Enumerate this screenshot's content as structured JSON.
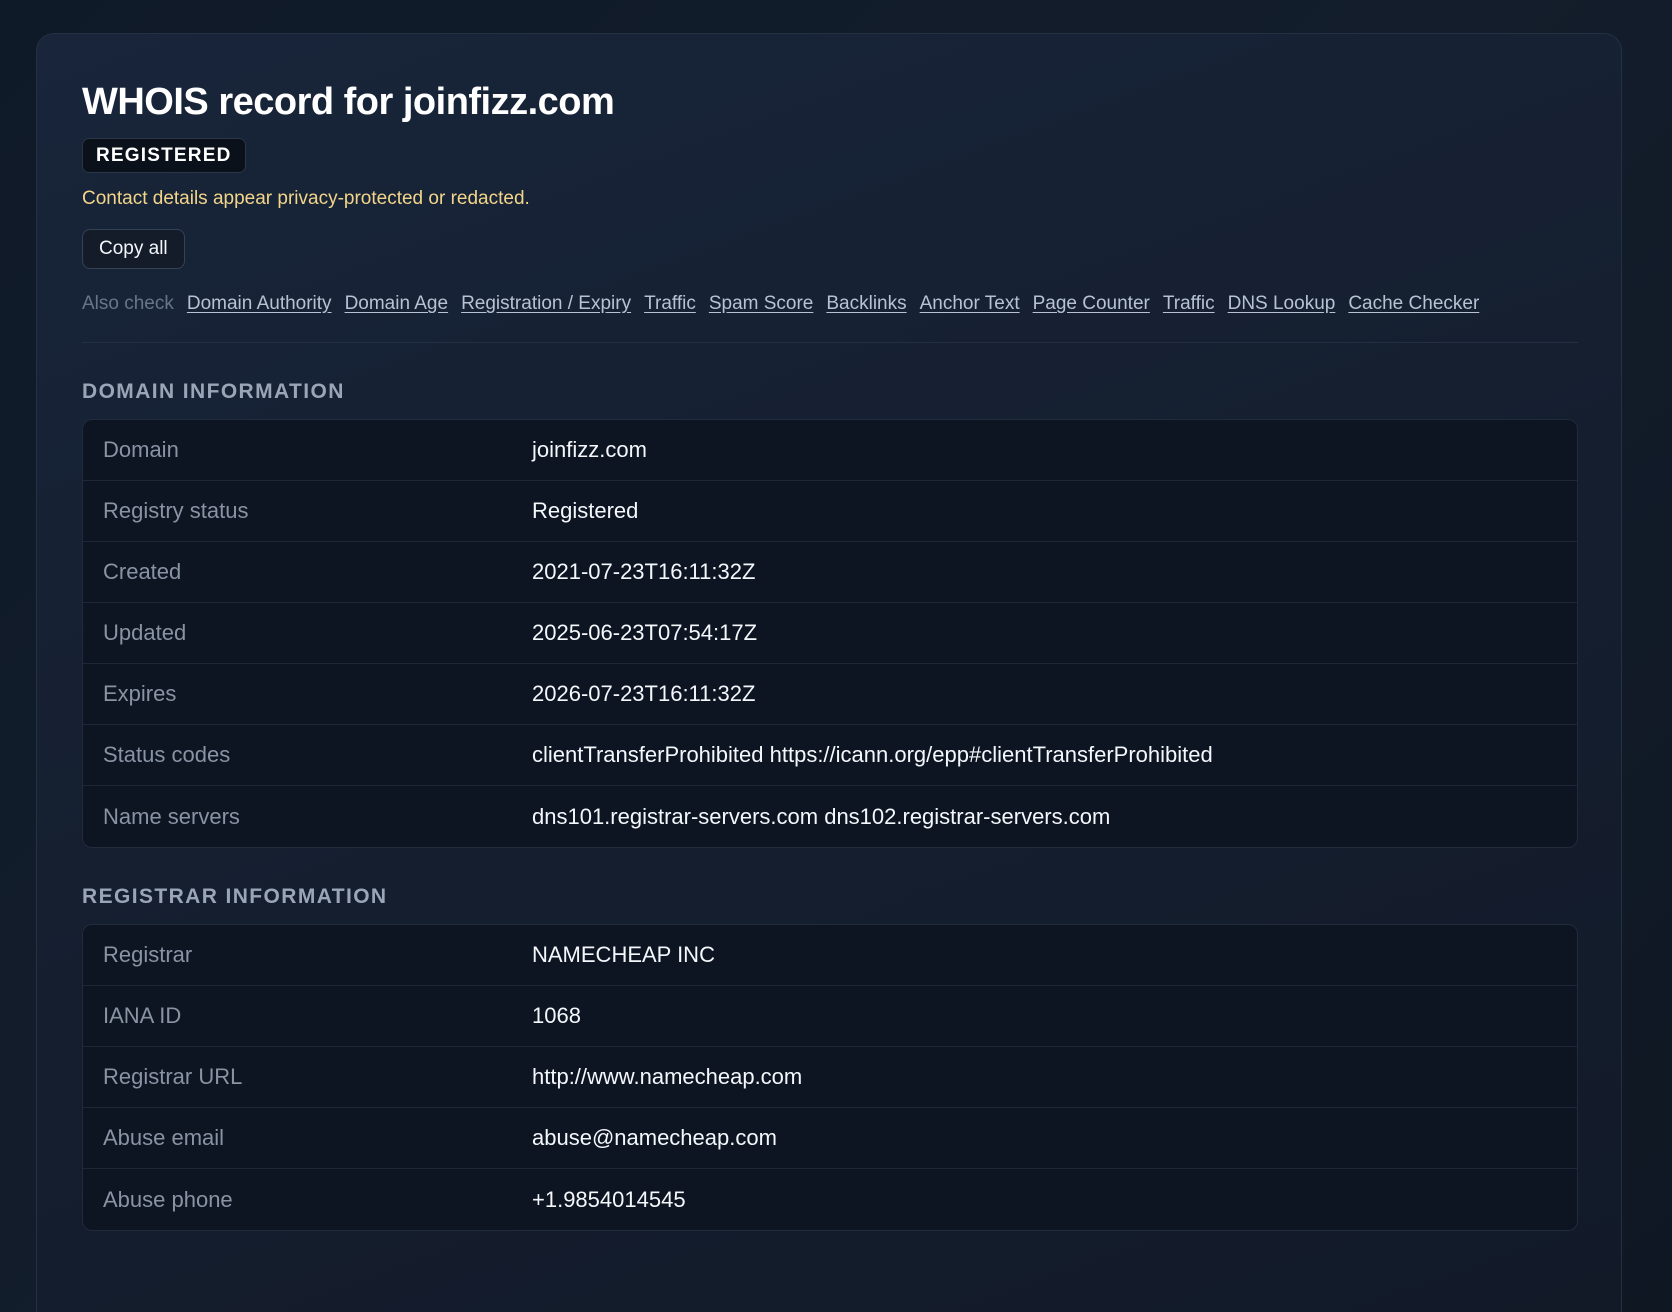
{
  "header": {
    "title": "WHOIS record for joinfizz.com",
    "badge": "REGISTERED",
    "notice": "Contact details appear privacy-protected or redacted.",
    "copy_label": "Copy all"
  },
  "also_check": {
    "label": "Also check",
    "links": [
      "Domain Authority",
      "Domain Age",
      "Registration / Expiry",
      "Traffic",
      "Spam Score",
      "Backlinks",
      "Anchor Text",
      "Page Counter",
      "Traffic",
      "DNS Lookup",
      "Cache Checker"
    ]
  },
  "domain_info": {
    "title": "DOMAIN INFORMATION",
    "rows": [
      {
        "key": "Domain",
        "value": "joinfizz.com"
      },
      {
        "key": "Registry status",
        "value": "Registered"
      },
      {
        "key": "Created",
        "value": "2021-07-23T16:11:32Z"
      },
      {
        "key": "Updated",
        "value": "2025-06-23T07:54:17Z"
      },
      {
        "key": "Expires",
        "value": "2026-07-23T16:11:32Z"
      },
      {
        "key": "Status codes",
        "value": "clientTransferProhibited https://icann.org/epp#clientTransferProhibited"
      },
      {
        "key": "Name servers",
        "value": "dns101.registrar-servers.com dns102.registrar-servers.com"
      }
    ]
  },
  "registrar_info": {
    "title": "REGISTRAR INFORMATION",
    "rows": [
      {
        "key": "Registrar",
        "value": "NAMECHEAP INC"
      },
      {
        "key": "IANA ID",
        "value": "1068"
      },
      {
        "key": "Registrar URL",
        "value": "http://www.namecheap.com"
      },
      {
        "key": "Abuse email",
        "value": "abuse@namecheap.com"
      },
      {
        "key": "Abuse phone",
        "value": "+1.9854014545"
      }
    ]
  }
}
